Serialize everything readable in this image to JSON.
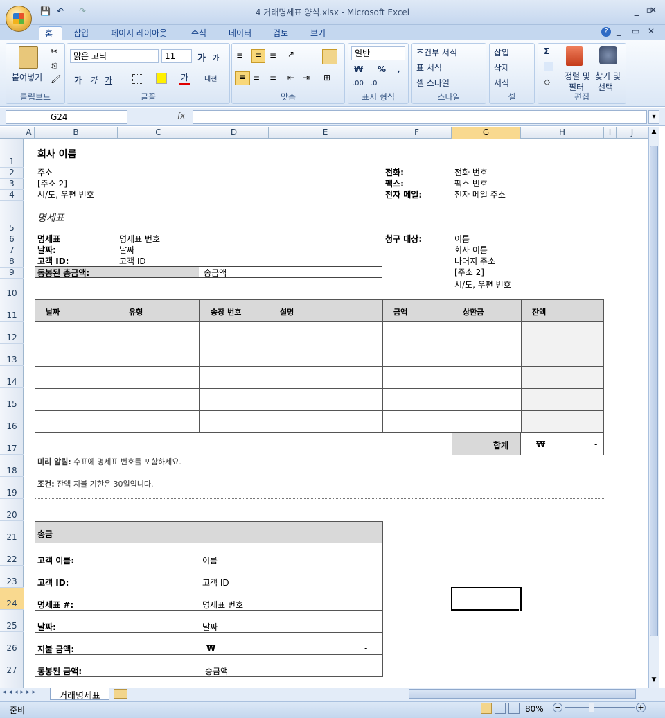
{
  "window": {
    "title": "4 거래명세표 양식.xlsx - Microsoft Excel",
    "qat": [
      "💾",
      "↶",
      "↷"
    ]
  },
  "tabs": [
    "홈",
    "삽입",
    "페이지 레이아웃",
    "수식",
    "데이터",
    "검토",
    "보기"
  ],
  "ribbon": {
    "clipboard": {
      "paste": "붙여넣기",
      "label": "클립보드"
    },
    "font": {
      "name": "맑은 고딕",
      "size": "11",
      "grow": "가",
      "shrink": "가",
      "bold": "가",
      "italic": "가",
      "underline": "가",
      "color": "가",
      "phonetic": "내천",
      "label": "글꼴"
    },
    "align": {
      "label": "맞춤"
    },
    "number": {
      "format": "일반",
      "currency": "₩",
      "percent": "%",
      "comma": ",",
      "inc": ".00",
      "dec": ".0",
      "label": "표시 형식"
    },
    "styles": {
      "cond": "조건부 서식",
      "table": "표 서식",
      "cell": "셀 스타일",
      "label": "스타일"
    },
    "cells": {
      "insert": "삽입",
      "delete": "삭제",
      "format": "서식",
      "label": "셀"
    },
    "edit": {
      "sigma": "Σ",
      "sort": "정렬 및",
      "sort2": "필터",
      "find": "찾기 및",
      "find2": "선택",
      "label": "편집"
    }
  },
  "formula_bar": {
    "namebox": "G24",
    "fx": "fx",
    "value": ""
  },
  "columns": [
    "A",
    "B",
    "C",
    "D",
    "E",
    "F",
    "G",
    "H",
    "I",
    "J"
  ],
  "rows": [
    "1",
    "2",
    "3",
    "4",
    "5",
    "6",
    "7",
    "8",
    "9",
    "10",
    "11",
    "12",
    "13",
    "14",
    "15",
    "16",
    "17",
    "18",
    "19",
    "20",
    "21",
    "22",
    "23",
    "24",
    "25",
    "26",
    "27"
  ],
  "sheet": {
    "company": "회사 이름",
    "address": [
      "주소",
      "[주소 2]",
      "시/도, 우편 번호"
    ],
    "contact": [
      [
        "전화:",
        "전화 번호"
      ],
      [
        "팩스:",
        "팩스 번호"
      ],
      [
        "전자 메일:",
        "전자 메일 주소"
      ]
    ],
    "heading": "명세표",
    "info": [
      [
        "명세표",
        "명세표 번호"
      ],
      [
        "날짜:",
        "날짜"
      ],
      [
        "고객 ID:",
        "고객 ID"
      ]
    ],
    "enclosed": [
      "동봉된 총금액:",
      "송금액"
    ],
    "billto": [
      "청구 대상:",
      "이름",
      "회사 이름",
      "나머지 주소",
      "[주소 2]",
      "시/도, 우편 번호"
    ],
    "table_headers": [
      "날짜",
      "유형",
      "송장 번호",
      "설명",
      "금액",
      "상환금",
      "잔액"
    ],
    "total": [
      "합계",
      "₩",
      "-"
    ],
    "note1": [
      "미리 알림:",
      " 수표에 명세표 번호를 포함하세요."
    ],
    "note2": [
      "조건:",
      " 잔액 지불 기한은 30일입니다."
    ],
    "remit_title": "송금",
    "remit": [
      [
        "고객 이름:",
        "이름"
      ],
      [
        "고객 ID:",
        "고객 ID"
      ],
      [
        "명세표 #:",
        "명세표 번호"
      ],
      [
        "날짜:",
        "날짜"
      ],
      [
        "지불 금액:",
        "₩",
        "-"
      ],
      [
        "동봉된 금액:",
        "송금액"
      ]
    ]
  },
  "sheet_tab": "거래명세표",
  "status": {
    "ready": "준비",
    "zoom": "80%"
  }
}
